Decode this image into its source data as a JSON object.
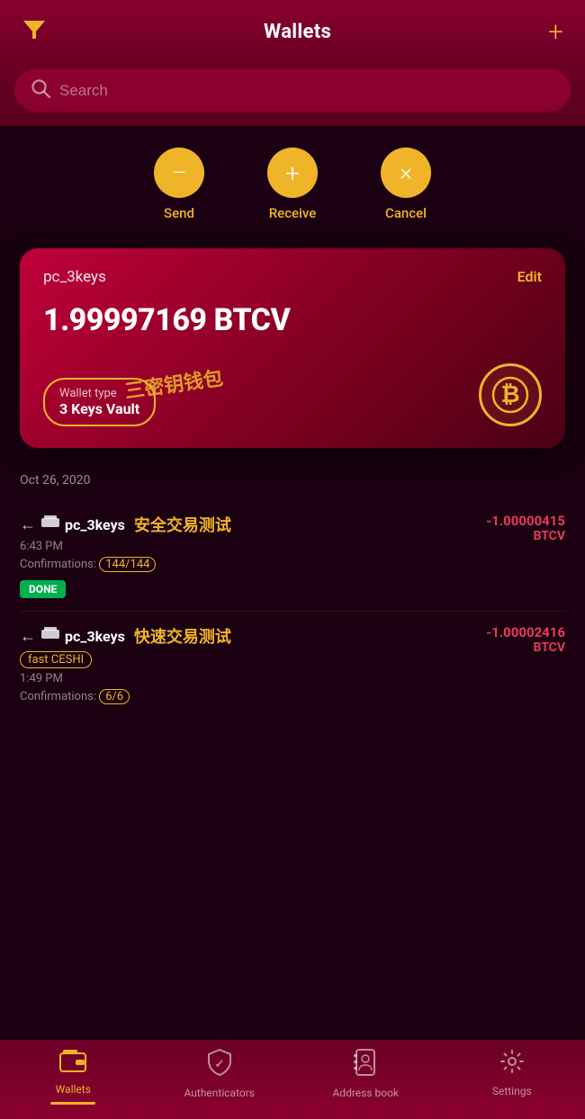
{
  "header": {
    "title": "Wallets",
    "filter_icon": "▼",
    "add_icon": "+"
  },
  "search": {
    "placeholder": "Search"
  },
  "actions": [
    {
      "id": "send",
      "icon": "−",
      "label": "Send"
    },
    {
      "id": "receive",
      "icon": "+",
      "label": "Receive"
    },
    {
      "id": "cancel",
      "icon": "×",
      "label": "Cancel"
    }
  ],
  "wallet_card": {
    "name": "pc_3keys",
    "edit_label": "Edit",
    "balance": "1.99997169 BTCV",
    "wallet_type_label": "Wallet type",
    "wallet_type_name": "3 Keys Vault",
    "watermark": "三密钥钱包"
  },
  "transactions": {
    "date": "Oct 26, 2020",
    "items": [
      {
        "arrow": "←",
        "wallet_icon": "▬",
        "wallet_name": "pc_3keys",
        "chinese_note": "安全交易测试",
        "time": "6:43 PM",
        "confirmations_label": "Confirmations:",
        "confirmations_value": "144/144",
        "badge": "DONE",
        "amount": "-1.00000415",
        "currency": "BTCV"
      },
      {
        "arrow": "←",
        "wallet_icon": "▬",
        "wallet_name": "pc_3keys",
        "chinese_note": "快速交易测试",
        "time": "1:49 PM",
        "confirmations_label": "Confirmations:",
        "confirmations_value": "6/6",
        "badge_label": "fast CESHI",
        "amount": "-1.00002416",
        "currency": "BTCV"
      }
    ]
  },
  "bottom_nav": [
    {
      "id": "wallets",
      "icon": "wallet",
      "label": "Wallets",
      "active": true
    },
    {
      "id": "authenticators",
      "icon": "shield",
      "label": "Authenticators",
      "active": false
    },
    {
      "id": "addressbook",
      "icon": "book",
      "label": "Address book",
      "active": false
    },
    {
      "id": "settings",
      "icon": "gear",
      "label": "Settings",
      "active": false
    }
  ]
}
